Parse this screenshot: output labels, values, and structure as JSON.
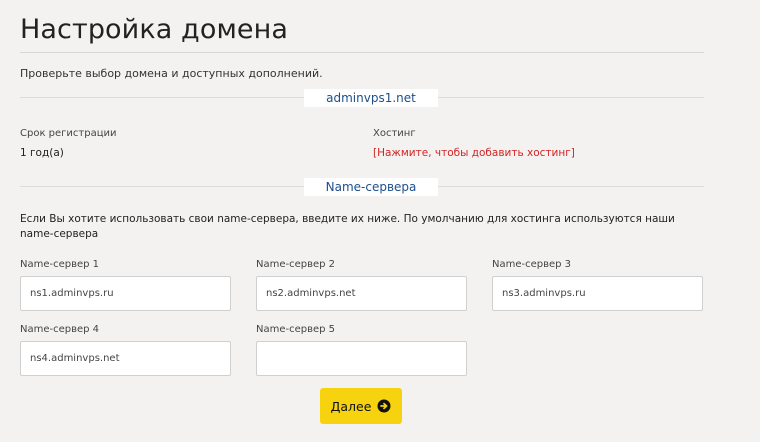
{
  "page": {
    "title": "Настройка домена",
    "intro": "Проверьте выбор домена и доступных дополнений."
  },
  "domain_section": {
    "domain": "adminvps1.net",
    "registration_label": "Срок регистрации",
    "registration_value": "1 год(а)",
    "hosting_label": "Хостинг",
    "hosting_link": "[Нажмите, чтобы добавить хостинг]"
  },
  "nameservers": {
    "heading": "Name-сервера",
    "info": "Если Вы хотите использовать свои name-сервера, введите их ниже. По умолчанию для хостинга используются наши name-сервера",
    "fields": [
      {
        "label": "Name-сервер 1",
        "value": "ns1.adminvps.ru"
      },
      {
        "label": "Name-сервер 2",
        "value": "ns2.adminvps.net"
      },
      {
        "label": "Name-сервер 3",
        "value": "ns3.adminvps.ru"
      },
      {
        "label": "Name-сервер 4",
        "value": "ns4.adminvps.net"
      },
      {
        "label": "Name-сервер 5",
        "value": ""
      }
    ]
  },
  "actions": {
    "next_label": "Далее",
    "next_icon": "arrow-circle-right-icon"
  },
  "colors": {
    "accent_button": "#f6d20f",
    "section_heading": "#1e4f8a",
    "link_red": "#d42424"
  }
}
